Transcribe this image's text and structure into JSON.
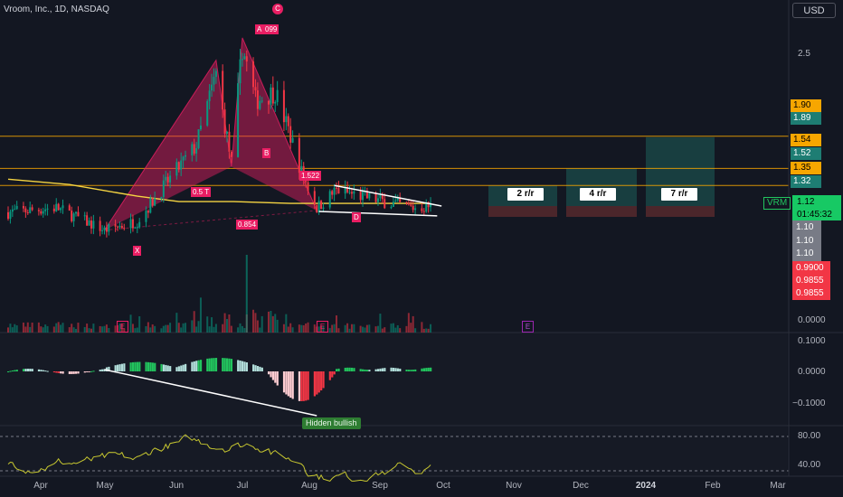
{
  "header": {
    "title": "Vroom, Inc., 1D, NASDAQ",
    "currency": "USD"
  },
  "colors": {
    "background": "#131722",
    "up": "#089981",
    "down": "#f23645",
    "pattern": "#e91e63",
    "ma": "#f5d442",
    "level": "#f7a600",
    "rsi": "#c6c630",
    "teal_zone": "#1e5f5a",
    "red_zone": "#5a2a2e"
  },
  "chart_data": [
    {
      "type": "candlestick",
      "title": "Vroom, Inc., 1D, NASDAQ",
      "x_ticks": [
        "Apr",
        "May",
        "Jun",
        "Jul",
        "Aug",
        "Sep",
        "Oct",
        "Nov",
        "Dec",
        "2024",
        "Feb",
        "Mar"
      ],
      "y_ticks": [
        2.5
      ],
      "path_points": [
        {
          "label": "X",
          "date": "2023-05-17",
          "price": 0.85
        },
        {
          "label": "A",
          "date": "2023-07-07",
          "price": 2.75
        },
        {
          "label": "B",
          "date": "2023-07-14",
          "price": 1.56
        },
        {
          "label": "C",
          "date": "2023-07-19",
          "price": 3.0
        },
        {
          "label": "D",
          "date": "2023-08-22",
          "price": 1.07
        }
      ],
      "ratios": [
        "099",
        "1.522",
        "0.854",
        "0.5 T"
      ],
      "horizontal_levels": [
        1.9,
        1.54,
        1.35
      ],
      "moving_average_recent": 1.15,
      "risk_reward_zones": [
        {
          "label": "2 r/r",
          "target": 1.35
        },
        {
          "label": "4 r/r",
          "target": 1.54
        },
        {
          "label": "7 r/r",
          "target": 1.89
        }
      ],
      "price_labels": [
        {
          "text": "1.90",
          "style": "orange"
        },
        {
          "text": "1.89",
          "style": "teal"
        },
        {
          "text": "1.54",
          "style": "orange"
        },
        {
          "text": "1.52",
          "style": "teal"
        },
        {
          "text": "1.35",
          "style": "orange"
        },
        {
          "text": "1.32",
          "style": "teal"
        },
        {
          "text": "1.12",
          "style": "green"
        },
        {
          "text": "01:45:32",
          "style": "green"
        },
        {
          "text": "1.10",
          "style": "gray"
        },
        {
          "text": "1.10",
          "style": "gray"
        },
        {
          "text": "1.10",
          "style": "gray"
        },
        {
          "text": "0.9900",
          "style": "red"
        },
        {
          "text": "0.9855",
          "style": "red"
        },
        {
          "text": "0.9855",
          "style": "red"
        }
      ],
      "symbol_tag": "VRM",
      "event_markers": [
        "E",
        "E",
        "E"
      ]
    },
    {
      "type": "bar",
      "title": "Volume",
      "y_ticks": [
        "0.0000"
      ]
    },
    {
      "type": "histogram",
      "title": "MACD histogram",
      "y_ticks": [
        "0.1000",
        "0.0000",
        "−0.1000"
      ],
      "annotation": "Hidden bullish"
    },
    {
      "type": "line",
      "title": "RSI",
      "y_ticks": [
        "80.00",
        "40.00"
      ],
      "series": [
        {
          "values_range": [
            30,
            80
          ]
        }
      ]
    }
  ]
}
